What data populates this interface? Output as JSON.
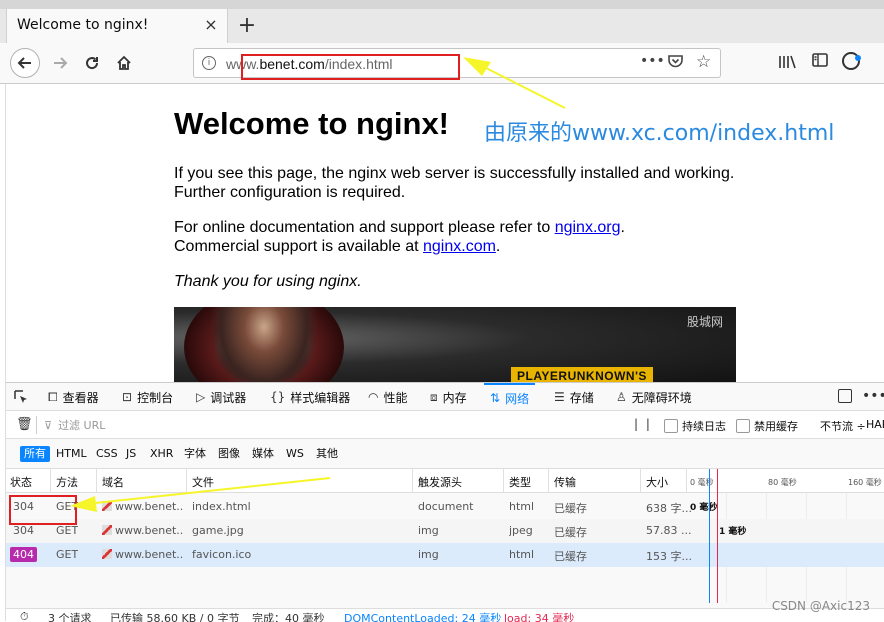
{
  "tab": {
    "title": "Welcome to nginx!",
    "close": "×",
    "new_tab": "+"
  },
  "nav": {
    "url_prefix": "www.",
    "url_host": "benet.com",
    "url_path": "/index.html",
    "url_more": "•••"
  },
  "page": {
    "heading": "Welcome to nginx!",
    "p1_line1": "If you see this page, the nginx web server is successfully installed and working.",
    "p1_line2": "Further configuration is required.",
    "p2_line1_pre": "For online documentation and support please refer to ",
    "p2_link1": "nginx.org",
    "p2_line1_post": ".",
    "p2_line2_pre": "Commercial support is available at ",
    "p2_link2": "nginx.com",
    "p2_line2_post": ".",
    "p3": "Thank you for using nginx.",
    "banner_logo": "PLAYERUNKNOWN'S",
    "banner_watermark": "股城网"
  },
  "annotation": {
    "text": "由原来的www.xc.com/index.html"
  },
  "devtools": {
    "tabs": {
      "inspector": "查看器",
      "console": "控制台",
      "debugger": "调试器",
      "style": "样式编辑器",
      "performance": "性能",
      "memory": "内存",
      "network": "网络",
      "storage": "存储",
      "accessibility": "无障碍环境"
    },
    "filter_placeholder": "过滤 URL",
    "persist_logs": "持续日志",
    "disable_cache": "禁用缓存",
    "throttle": "不节流 ÷",
    "har": "HAR",
    "types": [
      "所有",
      "HTML",
      "CSS",
      "JS",
      "XHR",
      "字体",
      "图像",
      "媒体",
      "WS",
      "其他"
    ],
    "headers": {
      "status": "状态",
      "method": "方法",
      "domain": "域名",
      "file": "文件",
      "cause": "触发源头",
      "type": "类型",
      "transfer": "传输",
      "size": "大小",
      "tick0": "0 毫秒",
      "tick80": "80 毫秒",
      "tick160": "160 毫秒"
    },
    "requests": [
      {
        "status": "304",
        "method": "GET",
        "domain": "www.benet....",
        "file": "index.html",
        "cause": "document",
        "type": "html",
        "transfer": "已缓存",
        "size": "638 字...",
        "timing": "0 毫秒"
      },
      {
        "status": "304",
        "method": "GET",
        "domain": "www.benet....",
        "file": "game.jpg",
        "cause": "img",
        "type": "jpeg",
        "transfer": "已缓存",
        "size": "57.83 ...",
        "timing": "1 毫秒"
      },
      {
        "status": "404",
        "method": "GET",
        "domain": "www.benet....",
        "file": "favicon.ico",
        "cause": "img",
        "type": "html",
        "transfer": "已缓存",
        "size": "153 字...",
        "timing": ""
      }
    ],
    "status": {
      "requests": "3 个请求",
      "transferred": "已传输 58.60 KB / 0 字节",
      "finish": "完成：40 毫秒",
      "dom": "DOMContentLoaded: 24 毫秒",
      "load": "load: 34 毫秒"
    }
  },
  "watermark": "CSDN @Axic123"
}
